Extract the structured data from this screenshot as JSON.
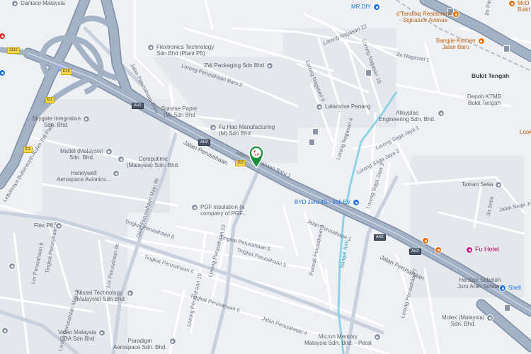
{
  "pois": [
    {
      "id": "danisco",
      "label": "Danisco Malaysia",
      "style": "gray"
    },
    {
      "id": "flextronics",
      "label": "Flextronics Technology\nSdn Bhd (Plant P5)",
      "style": "gray"
    },
    {
      "id": "zw",
      "label": "ZW Packaging Sdn Bhd",
      "style": "gray"
    },
    {
      "id": "sunrise",
      "label": "Sunrise Paper\n(M) Sdn Bhd",
      "style": "gray"
    },
    {
      "id": "fuhao",
      "label": "Fu Hao Manufacturing\n(M) Sdn Bhd",
      "style": "gray"
    },
    {
      "id": "lalamove",
      "label": "Lalamove Penang",
      "style": "gray"
    },
    {
      "id": "skygate",
      "label": "Skygate Integration\nSdn. Bhd.",
      "style": "gray"
    },
    {
      "id": "mattel",
      "label": "Mattel (Malaysia)\nSdn. Bhd.",
      "style": "gray"
    },
    {
      "id": "computime",
      "label": "Computime\n(Malaysia) Sdn. Bhd.",
      "style": "gray"
    },
    {
      "id": "honeywell",
      "label": "Honeywell\nAerospace Avionics...",
      "style": "gray"
    },
    {
      "id": "pgf",
      "label": "PGF Insulation (a\ncompany of PGF...",
      "style": "gray"
    },
    {
      "id": "flexp8",
      "label": "Flex P8",
      "style": "gray"
    },
    {
      "id": "nissei",
      "label": "Nissei Technology\n(Malaysia) Sdn Bhd",
      "style": "gray"
    },
    {
      "id": "valeo",
      "label": "Valeo Malaysia\nCDA Sdn Bhd",
      "style": "gray"
    },
    {
      "id": "paradigm",
      "label": "Paradigm\nAerospace Sdn. Bhd.",
      "style": "gray"
    },
    {
      "id": "micron",
      "label": "Micron Memory\nMalaysia Sdn. Bhd. - Perai",
      "style": "gray"
    },
    {
      "id": "molex",
      "label": "Molex (Malaysia)\nSdn. Bhd.",
      "style": "gray"
    },
    {
      "id": "alloyplas",
      "label": "Alloyplas\nEngineering Sdn. Bhd.",
      "style": "gray"
    },
    {
      "id": "tamansetia",
      "label": "Taman Setia",
      "style": "gray"
    },
    {
      "id": "depoh",
      "label": "Depoh KTMB\nBukit Tengah",
      "style": "gray"
    },
    {
      "id": "bukittengah",
      "label": "Bukit Tengah",
      "style": "bold"
    },
    {
      "id": "mrdiy",
      "label": "MR.DIY",
      "style": "blue"
    },
    {
      "id": "tandoor",
      "label": "d'Tandoor Restaurant\n- Signature Avenue",
      "style": "orange"
    },
    {
      "id": "bangjie",
      "label": "Bangjie Kitchen\nJalan Baru",
      "style": "orange"
    },
    {
      "id": "byd",
      "label": "BYD Juru 4S - Iroll EV",
      "style": "blue"
    },
    {
      "id": "fuhotel",
      "label": "Fu Hotel",
      "style": "pink"
    },
    {
      "id": "hentian",
      "label": "Hentian Sebelah\nJuru Arah Selatan",
      "style": "gray"
    },
    {
      "id": "shell",
      "label": "Shell",
      "style": "blue"
    },
    {
      "id": "mcdonalds",
      "label": "McD\nBukit",
      "style": "orange"
    },
    {
      "id": "look",
      "label": "Look",
      "style": "orange"
    }
  ],
  "roads": [
    {
      "id": "jp-baru-2",
      "label": "Lorong Perusahaan Baru 2"
    },
    {
      "id": "jp-baru",
      "label": "Jalan Perusahaan Baru"
    },
    {
      "id": "jp-baru-1",
      "label": "Jalan Perusahaan Baru 1"
    },
    {
      "id": "jalan-perusahaan",
      "label": "Jalan Perusahaan"
    },
    {
      "id": "jalan-perusahaan-r",
      "label": "Jalan Perusahaan"
    },
    {
      "id": "tingkat-5",
      "label": "Tingkat Perusahaan 5"
    },
    {
      "id": "tingkat-6a",
      "label": "Tingkat Perusahaan 6"
    },
    {
      "id": "tingkat-6b",
      "label": "Tingkat Perusahaan 6"
    },
    {
      "id": "tingkat-6c",
      "label": "Tingkat Perusahaan 6"
    },
    {
      "id": "tingkat-6d",
      "label": "Tingkat Perusahaan 6"
    },
    {
      "id": "jalan-p4",
      "label": "Jalan Perusahaan 4"
    },
    {
      "id": "lor-p8",
      "label": "Lor Perusahaan 8"
    },
    {
      "id": "lor-p8c",
      "label": "Lor Perusahaan 8c"
    },
    {
      "id": "lor-maju-8",
      "label": "Lorong Perusahaan Maju 8"
    },
    {
      "id": "lor-maju-8b",
      "label": "Jalan Perusahaan Maju 8b"
    },
    {
      "id": "lor-p10",
      "label": "Lorong Perusahaan 10"
    },
    {
      "id": "lor-p10-2",
      "label": "Lorong Perusahaan 10"
    },
    {
      "id": "lor-p5",
      "label": "Tingkat Perusahaan 5"
    },
    {
      "id": "lor-p7",
      "label": "Lorong Perusahaan 7"
    },
    {
      "id": "jalan-p1",
      "label": "Jalan Perusahaan 1"
    },
    {
      "id": "puncak-p",
      "label": "Puncak Perusahaan 1"
    },
    {
      "id": "lor-nagasari-22",
      "label": "Lorong Nagasari 22"
    },
    {
      "id": "lor-nagasari-18",
      "label": "Lorong Nagasari 18"
    },
    {
      "id": "lor-nagasari-9",
      "label": "Lorong Nagasari 9"
    },
    {
      "id": "lor-nagasari-4",
      "label": "Lorong Nagasari 4"
    },
    {
      "id": "jln-nagasari-1",
      "label": "Jln Nagasari 1"
    },
    {
      "id": "lor-saga-2",
      "label": "Lorong Saga Jaya 2"
    },
    {
      "id": "lor-saga-3",
      "label": "Lorong Saga Jaya 3"
    },
    {
      "id": "lor-saga-1",
      "label": "Lorong Saga Jaya 1"
    },
    {
      "id": "jln-saga-3",
      "label": "Jalan Saga Jaya 3"
    },
    {
      "id": "jln-setia",
      "label": "Jln Setia"
    },
    {
      "id": "jln-pauh",
      "label": "Jln Pauh 1"
    },
    {
      "id": "toll-pauh",
      "label": "Lebuhraya Butterworth-Kulim Toll Pauh"
    },
    {
      "id": "sungai-juru",
      "label": "Sungai Juru"
    }
  ],
  "shields": [
    {
      "id": "s3112",
      "label": "3112"
    },
    {
      "id": "s26",
      "label": "E26"
    },
    {
      "id": "s1",
      "label": "E1"
    },
    {
      "id": "s2",
      "label": "E1"
    },
    {
      "id": "sah2a",
      "label": "AH2"
    },
    {
      "id": "sah2b",
      "label": "AH2"
    },
    {
      "id": "sah2c",
      "label": "AH2"
    },
    {
      "id": "sah2d",
      "label": "AH2"
    },
    {
      "id": "sah2e",
      "label": "AH2"
    },
    {
      "id": "s153",
      "label": "153"
    }
  ],
  "selected_place": {
    "icon": "selected-place-pin-icon"
  },
  "colors": {
    "background": "#eef0f4",
    "highway": "#9aa8bc",
    "highway_edge": "#7d8ea6",
    "minor_road": "#ffffff",
    "water": "#8fd3e8",
    "pin": "#1e8e3e"
  }
}
